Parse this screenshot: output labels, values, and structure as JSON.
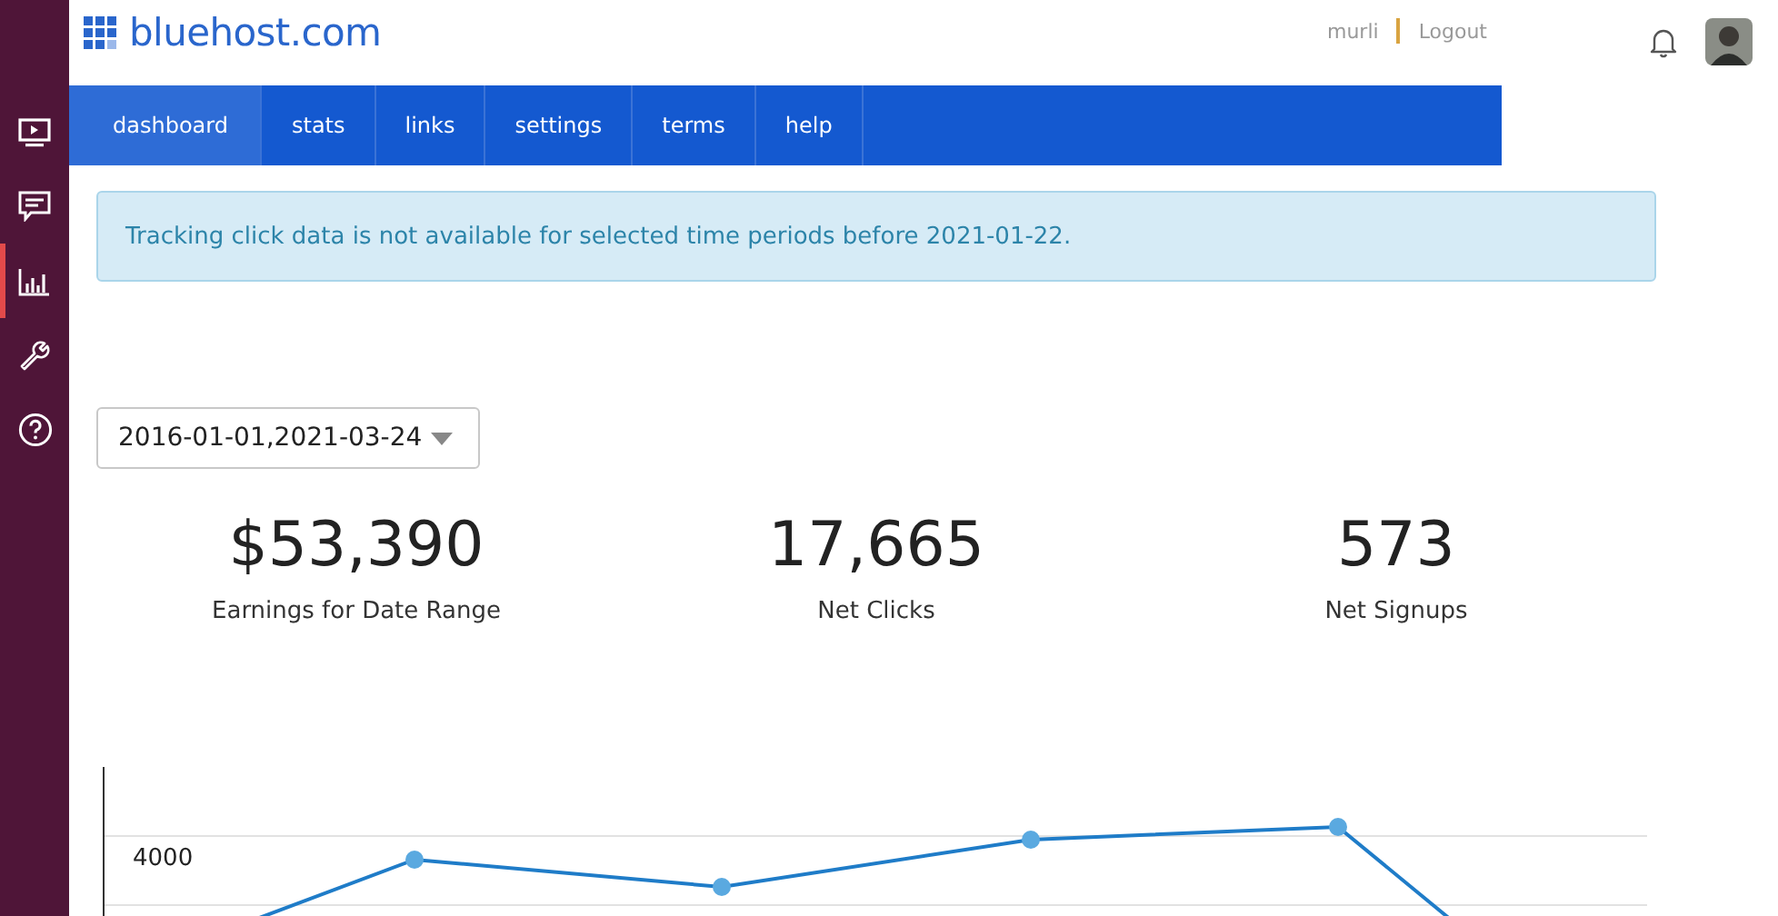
{
  "sidebar": {
    "items": [
      {
        "kind": "video",
        "selected": false
      },
      {
        "kind": "chat",
        "selected": false
      },
      {
        "kind": "chart",
        "selected": true
      },
      {
        "kind": "wrench",
        "selected": false
      },
      {
        "kind": "help",
        "selected": false
      }
    ]
  },
  "header": {
    "logo": "bluehost.com",
    "user": "murli",
    "logout": "Logout"
  },
  "tabs": [
    {
      "label": "dashboard",
      "selected": true
    },
    {
      "label": "stats",
      "selected": false
    },
    {
      "label": "links",
      "selected": false
    },
    {
      "label": "settings",
      "selected": false
    },
    {
      "label": "terms",
      "selected": false
    },
    {
      "label": "help",
      "selected": false
    }
  ],
  "alert": "Tracking click data is not available for selected time periods before 2021-01-22.",
  "date_range": "2016-01-01,2021-03-24",
  "stats": [
    {
      "value": "$53,390",
      "label": "Earnings for Date Range"
    },
    {
      "value": "17,665",
      "label": "Net Clicks"
    },
    {
      "value": "573",
      "label": "Net Signups"
    }
  ],
  "chart": {
    "y_tick_label": "4000"
  }
}
